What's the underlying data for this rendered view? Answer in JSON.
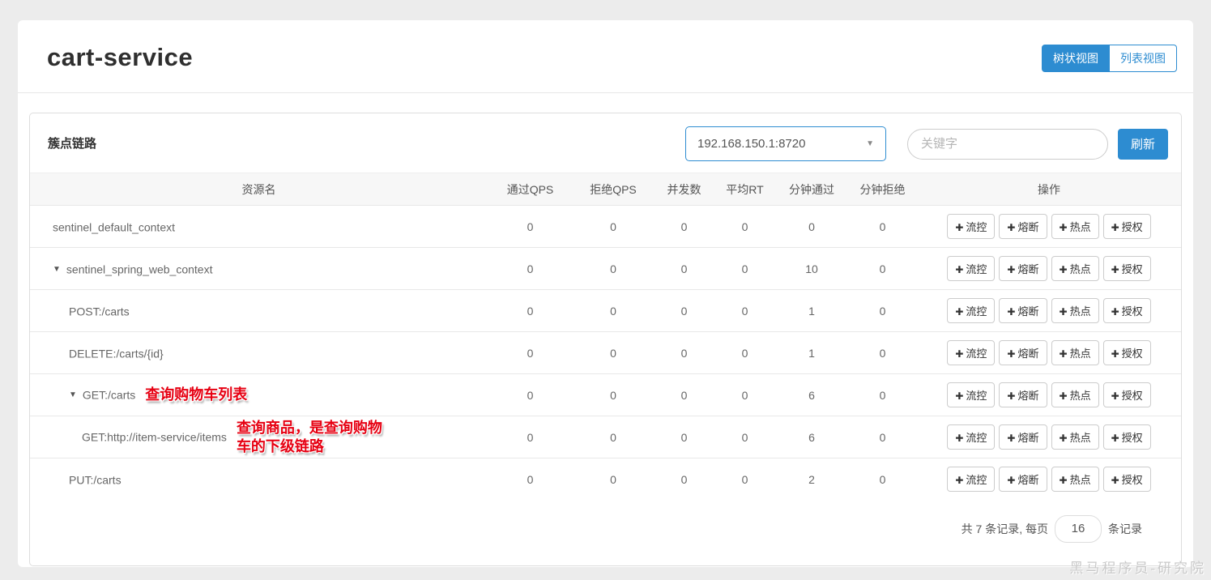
{
  "page": {
    "title": "cart-service",
    "watermark": "黑马程序员-研究院"
  },
  "view_toggle": {
    "tree_label": "树状视图",
    "list_label": "列表视图",
    "active": "tree"
  },
  "panel": {
    "title": "簇点链路",
    "machine_select": {
      "value": "192.168.150.1:8720"
    },
    "search": {
      "placeholder": "关键字"
    },
    "refresh_label": "刷新"
  },
  "table": {
    "headers": [
      "资源名",
      "通过QPS",
      "拒绝QPS",
      "并发数",
      "平均RT",
      "分钟通过",
      "分钟拒绝",
      "操作"
    ],
    "action_labels": [
      "流控",
      "熔断",
      "热点",
      "授权"
    ],
    "plus_icon": "✚",
    "caret_icon": "▼",
    "rows": [
      {
        "name": "sentinel_default_context",
        "level": 0,
        "expandable": false,
        "annotation": "",
        "values": [
          0,
          0,
          0,
          0,
          0,
          0
        ]
      },
      {
        "name": "sentinel_spring_web_context",
        "level": 0,
        "expandable": true,
        "annotation": "",
        "values": [
          0,
          0,
          0,
          0,
          10,
          0
        ]
      },
      {
        "name": "POST:/carts",
        "level": 1,
        "expandable": false,
        "annotation": "",
        "values": [
          0,
          0,
          0,
          0,
          1,
          0
        ]
      },
      {
        "name": "DELETE:/carts/{id}",
        "level": 1,
        "expandable": false,
        "annotation": "",
        "values": [
          0,
          0,
          0,
          0,
          1,
          0
        ]
      },
      {
        "name": "GET:/carts",
        "level": 1,
        "expandable": true,
        "annotation": "查询购物车列表",
        "values": [
          0,
          0,
          0,
          0,
          6,
          0
        ]
      },
      {
        "name": "GET:http://item-service/items",
        "level": 2,
        "expandable": false,
        "annotation": "查询商品，是查询购物车的下级链路",
        "values": [
          0,
          0,
          0,
          0,
          6,
          0
        ]
      },
      {
        "name": "PUT:/carts",
        "level": 1,
        "expandable": false,
        "annotation": "",
        "values": [
          0,
          0,
          0,
          0,
          2,
          0
        ]
      }
    ],
    "footer": {
      "total_text": "共 7 条记录, 每页",
      "page_size": "16",
      "suffix_text": "条记录"
    }
  },
  "colors": {
    "primary_blue": "#2d8cd1",
    "annotation_red": "#e60012"
  }
}
